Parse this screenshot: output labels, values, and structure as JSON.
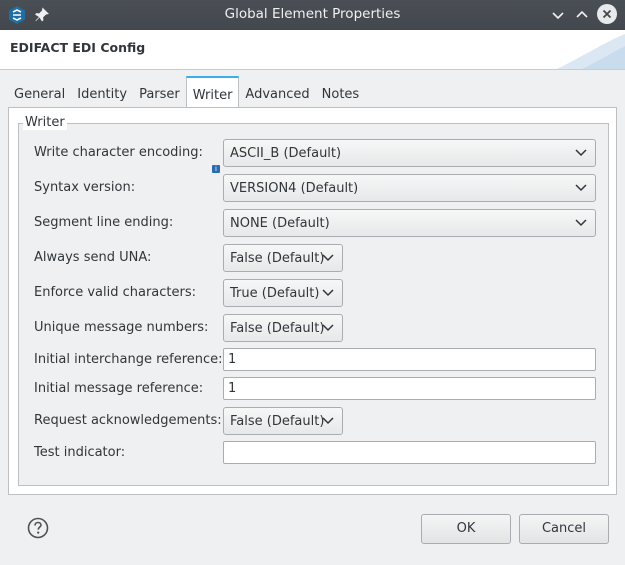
{
  "window": {
    "title": "Global Element Properties"
  },
  "header": {
    "title": "EDIFACT EDI Config"
  },
  "tabs": [
    {
      "label": "General"
    },
    {
      "label": "Identity"
    },
    {
      "label": "Parser"
    },
    {
      "label": "Writer",
      "active": true
    },
    {
      "label": "Advanced"
    },
    {
      "label": "Notes"
    }
  ],
  "writer": {
    "group_title": "Writer",
    "fields": {
      "char_encoding": {
        "label": "Write character encoding:",
        "value": "ASCII_B (Default)"
      },
      "syntax_version": {
        "label": "Syntax version:",
        "value": "VERSION4 (Default)"
      },
      "segment_line_ending": {
        "label": "Segment line ending:",
        "value": "NONE (Default)"
      },
      "always_send_una": {
        "label": "Always send UNA:",
        "value": "False (Default)"
      },
      "enforce_valid_chars": {
        "label": "Enforce valid characters:",
        "value": "True (Default)"
      },
      "unique_msg_numbers": {
        "label": "Unique message numbers:",
        "value": "False (Default)"
      },
      "initial_interchange_ref": {
        "label": "Initial interchange reference:",
        "value": "1"
      },
      "initial_message_ref": {
        "label": "Initial message reference:",
        "value": "1"
      },
      "request_acks": {
        "label": "Request acknowledgements:",
        "value": "False (Default)"
      },
      "test_indicator": {
        "label": "Test indicator:",
        "value": ""
      }
    }
  },
  "footer": {
    "ok_label": "OK",
    "cancel_label": "Cancel"
  },
  "colors": {
    "titlebar": "#474c52",
    "accent": "#3daee9",
    "background": "#eff0f1"
  },
  "icons": {
    "app": "app-logo-icon",
    "pin": "pin-icon",
    "minimize": "chevron-down-icon",
    "maximize": "chevron-up-icon",
    "close": "close-icon",
    "help": "help-icon",
    "info": "info-icon"
  }
}
